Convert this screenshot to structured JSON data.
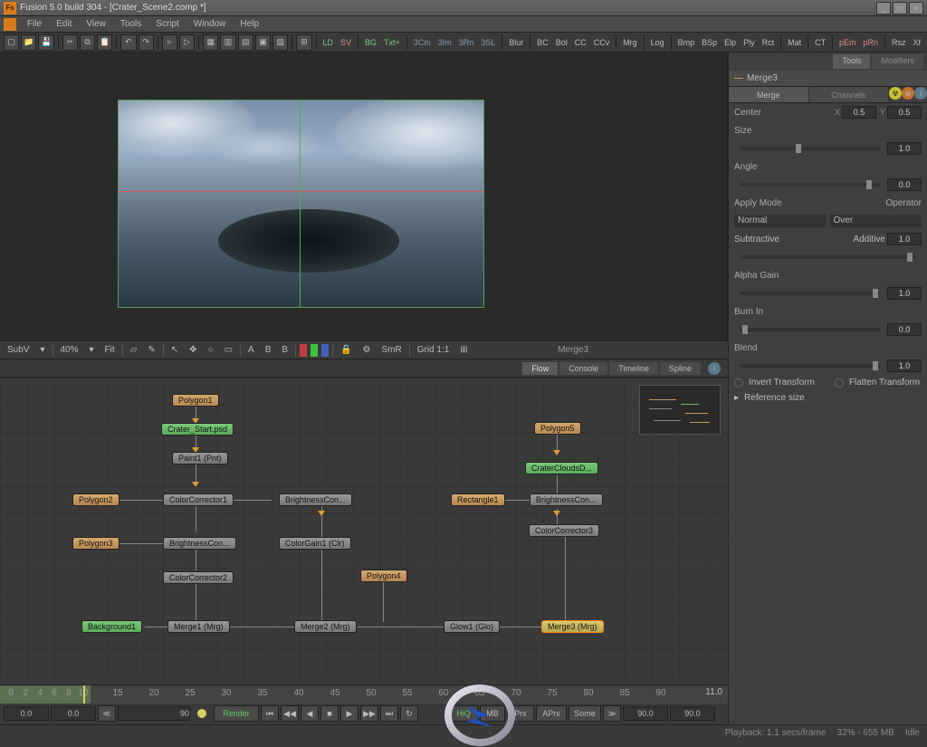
{
  "title": "Fusion 5.0 build 304 - [Crater_Scene2.comp *]",
  "menu": [
    "File",
    "Edit",
    "View",
    "Tools",
    "Script",
    "Window",
    "Help"
  ],
  "toolbar_text": {
    "ld": "LD",
    "sv": "SV",
    "bg": "BG",
    "txtp": "Txt+",
    "cm3": "3Cm",
    "im3": "3Im",
    "rn3": "3Rn",
    "sl3": "3SL",
    "blur": "Blur",
    "bc": "BC",
    "bol": "Bol",
    "cc": "CC",
    "ccv": "CCv",
    "mrg": "Mrg",
    "log": "Log",
    "bmp": "Bmp",
    "bsp": "BSp",
    "elp": "Elp",
    "ply": "Ply",
    "rct": "Rct",
    "mat": "Mat",
    "ct": "CT",
    "pem": "pEm",
    "prn": "pRn",
    "rsz": "Rsz",
    "xf": "Xf"
  },
  "viewer": {
    "zoom_mode": "SubV",
    "zoom": "40%",
    "fit": "Fit",
    "grid": "Grid  1:1",
    "smr": "SmR",
    "label": "Merge3"
  },
  "flow_tabs": [
    "Flow",
    "Console",
    "Timeline",
    "Spline"
  ],
  "nodes": {
    "polygon1": "Polygon1",
    "crater_start": "Crater_Start.psd",
    "paint1": "Paint1 (Pnt)",
    "polygon2": "Polygon2",
    "colorcor1": "ColorCorrector1",
    "brightcon1": "BrightnessCon...",
    "polygon3": "Polygon3",
    "brightcon2": "BrightnessCon...",
    "colorgain1": "ColorGain1 (Clr)",
    "colorcor2": "ColorCorrector2",
    "polygon4": "Polygon4",
    "background1": "Background1",
    "merge1": "Merge1 (Mrg)",
    "merge2": "Merge2 (Mrg)",
    "glow1": "Glow1 (Glo)",
    "merge3": "Merge3 (Mrg)",
    "polygon5": "Polygon5",
    "craterclouds": "CraterCloudsD...",
    "rectangle1": "Rectangle1",
    "brightcon3": "BrightnessCon...",
    "colorcor3": "ColorCorrector3"
  },
  "timeline": {
    "ticks": [
      0,
      2,
      4,
      6,
      8,
      10,
      15,
      20,
      25,
      30,
      35,
      40,
      45,
      50,
      55,
      60,
      65,
      70,
      75,
      80,
      85,
      90
    ],
    "cur_in": "0.0",
    "cur_out": "0.0",
    "frame": "90",
    "end": "11.0",
    "render": "Render",
    "hiq": "HiQ",
    "mb": "MB",
    "prx": "Prx",
    "aprx": "APrx",
    "some": "Some",
    "range1": "90.0",
    "range2": "90.0"
  },
  "props": {
    "tabs": {
      "tools": "Tools",
      "modifiers": "Modifiers"
    },
    "node": "Merge3",
    "subtabs": {
      "merge": "Merge",
      "channels": "Channels"
    },
    "center": "Center",
    "center_x": "0.5",
    "center_y": "0.5",
    "size": "Size",
    "size_v": "1.0",
    "angle": "Angle",
    "angle_v": "0.0",
    "apply": "Apply Mode",
    "apply_v": "Normal",
    "operator": "Operator",
    "operator_v": "Over",
    "subtractive": "Subtractive",
    "additive": "Additive",
    "sub_add_v": "1.0",
    "alpha": "Alpha Gain",
    "alpha_v": "1.0",
    "burn": "Burn In",
    "burn_v": "0.0",
    "blend": "Blend",
    "blend_v": "1.0",
    "invert": "Invert Transform",
    "flatten": "Flatten Transform",
    "refsize": "Reference size"
  },
  "status": {
    "playback": "Playback: 1.1 secs/frame",
    "mem": "32% - 655 MB",
    "idle": "Idle"
  }
}
